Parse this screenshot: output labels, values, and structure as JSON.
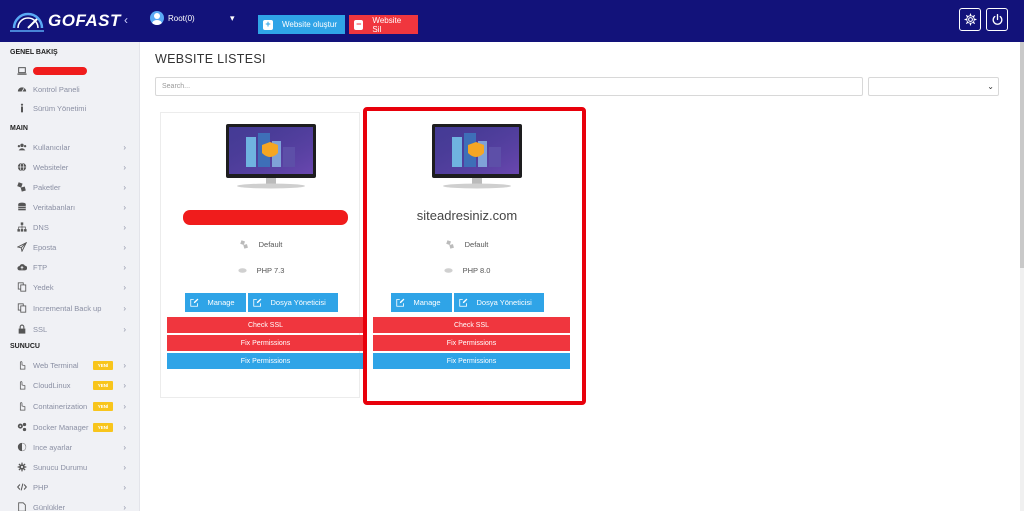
{
  "brand": {
    "name": "GOFAST"
  },
  "topbar": {
    "collapse_glyph": "‹",
    "user_name": "Root(0)",
    "user_caret": "▾",
    "create_label": "Website oluştur",
    "create_icon": "+",
    "delete_label": "Website Sil",
    "delete_icon": "−",
    "accent": "#2fa4e7",
    "danger": "#f0363e",
    "bar_color": "#12127a"
  },
  "sidebar": {
    "sections": {
      "overview": "GENEL BAKIŞ",
      "main": "MAIN",
      "server": "SUNUCU"
    },
    "overview_items": [
      {
        "label": "Kontrol Paneli",
        "icon": "dashboard-icon"
      },
      {
        "label": "Sürüm Yönetimi",
        "icon": "info-icon"
      }
    ],
    "main_items": [
      {
        "label": "Kullanıcılar",
        "icon": "users-icon"
      },
      {
        "label": "Websiteler",
        "icon": "globe-icon"
      },
      {
        "label": "Paketler",
        "icon": "packages-icon"
      },
      {
        "label": "Veritabanları",
        "icon": "database-icon"
      },
      {
        "label": "DNS",
        "icon": "sitemap-icon"
      },
      {
        "label": "Eposta",
        "icon": "paper-plane-icon"
      },
      {
        "label": "FTP",
        "icon": "cloud-upload-icon"
      },
      {
        "label": "Yedek",
        "icon": "copy-icon"
      },
      {
        "label": "Incremental Back up",
        "icon": "copy-icon"
      },
      {
        "label": "SSL",
        "icon": "lock-icon"
      }
    ],
    "server_items": [
      {
        "label": "Web Terminal",
        "icon": "pointer-icon",
        "badge": "YENİ"
      },
      {
        "label": "CloudLinux",
        "icon": "pointer-icon",
        "badge": "YENİ"
      },
      {
        "label": "Containerization",
        "icon": "pointer-icon",
        "badge": "YENİ"
      },
      {
        "label": "Docker Manager",
        "icon": "cogs-icon",
        "badge": "YENİ"
      },
      {
        "label": "Ince ayarlar",
        "icon": "adjust-icon"
      },
      {
        "label": "Sunucu Durumu",
        "icon": "cog-icon"
      },
      {
        "label": "PHP",
        "icon": "code-icon"
      },
      {
        "label": "Günlükler",
        "icon": "file-icon"
      }
    ],
    "chevron": "›"
  },
  "main": {
    "title": "WEBSITE LISTESI",
    "search_placeholder": "Search...",
    "select_caret": "⌄"
  },
  "cards": [
    {
      "domain": "",
      "package": "Default",
      "php": "PHP 7.3",
      "manage_label": "Manage",
      "files_label": "Dosya Yöneticisi",
      "ssl_label": "Check SSL",
      "fix_label_1": "Fix Permissions",
      "fix_label_2": "Fix Permissions"
    },
    {
      "domain": "siteadresiniz.com",
      "package": "Default",
      "php": "PHP 8.0",
      "manage_label": "Manage",
      "files_label": "Dosya Yöneticisi",
      "ssl_label": "Check SSL",
      "fix_label_1": "Fix Permissions",
      "fix_label_2": "Fix Permissions"
    }
  ]
}
